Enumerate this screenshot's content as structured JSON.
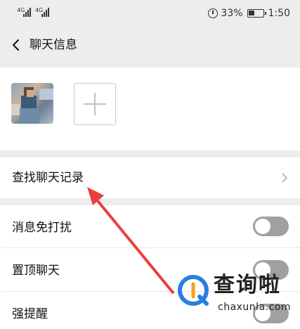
{
  "status_bar": {
    "signal_1": "4G",
    "signal_2": "4G",
    "battery_percent": "33%",
    "time": "1:50",
    "icons": [
      "signal-icon",
      "alarm-icon",
      "battery-icon"
    ]
  },
  "nav": {
    "title": "聊天信息",
    "back_icon": "chevron-left-icon"
  },
  "members": {
    "items": [
      {
        "name": ""
      }
    ],
    "add_icon": "plus-icon"
  },
  "rows": {
    "find_history": "查找聊天记录",
    "mute": "消息免打扰",
    "sticky": "置顶聊天",
    "remind": "强提醒"
  },
  "toggles": {
    "mute": false,
    "sticky": false,
    "remind": false
  },
  "annotation": {
    "arrow_color": "#e8413b"
  },
  "watermark": {
    "title": "查询啦",
    "domain": "chaxunla.com"
  },
  "colors": {
    "background": "#ededed",
    "toggle_off": "#a0a0a0"
  }
}
